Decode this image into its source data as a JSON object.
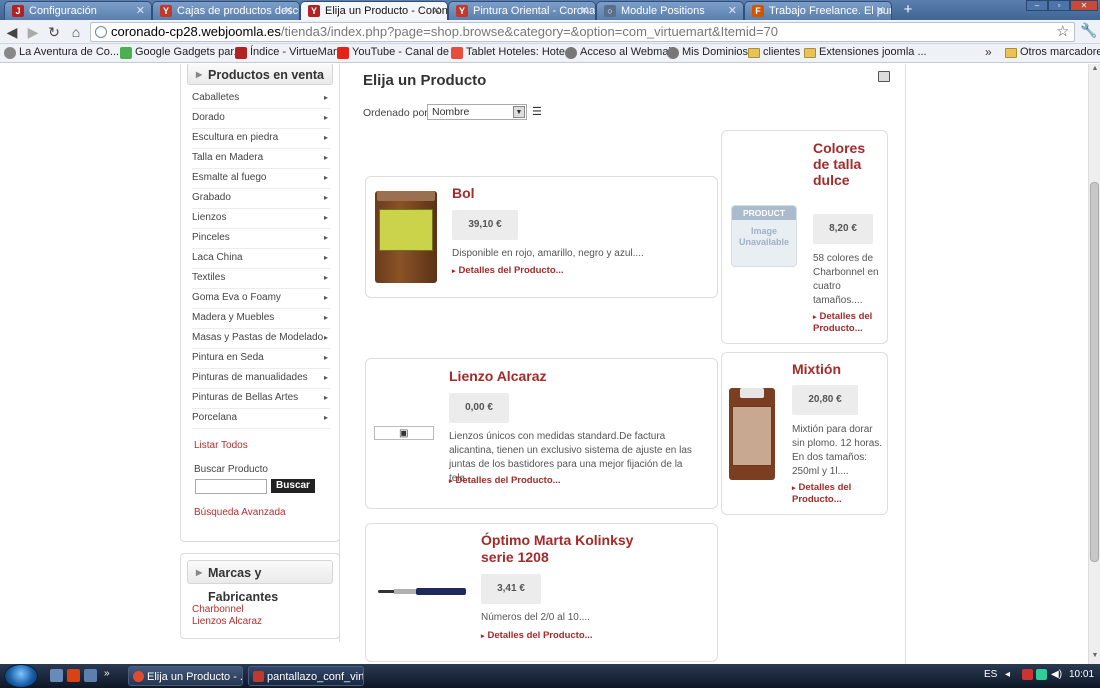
{
  "browser": {
    "tabs": [
      {
        "title": "Configuración",
        "fav": "J",
        "color": "#b22222"
      },
      {
        "title": "Cajas de productos descu",
        "fav": "Y",
        "color": "#c0392b"
      },
      {
        "title": "Elija un Producto - Corona",
        "fav": "Y",
        "color": "#b22222"
      },
      {
        "title": "Pintura Oriental - Coronad",
        "fav": "Y",
        "color": "#c0392b"
      },
      {
        "title": "Module Positions",
        "fav": "○",
        "color": "#5a6f8a"
      },
      {
        "title": "Trabajo Freelance. El punto",
        "fav": "F",
        "color": "#d35400"
      }
    ],
    "url_domain": "coronado-cp28.webjoomla.es",
    "url_path": "/tienda3/index.php?page=shop.browse&category=&option=com_virtuemart&Itemid=70",
    "bookmarks": [
      "La Aventura de Co...",
      "Google Gadgets par...",
      "Índice - VirtueMart",
      "YouTube - Canal de ...",
      "Tablet Hoteles: Hote...",
      "Acceso al Webmail",
      "Mis Dominios",
      "clientes",
      "Extensiones joomla ...",
      "Otros marcadores"
    ]
  },
  "sidebar": {
    "products_title": "Productos en venta",
    "categories": [
      "Caballetes",
      "Dorado",
      "Escultura en piedra",
      "Talla en Madera",
      "Esmalte al fuego",
      "Grabado",
      "Lienzos",
      "Pinceles",
      "Laca China",
      "Textiles",
      "Goma Eva o Foamy",
      "Madera y Muebles",
      "Masas y Pastas de Modelado",
      "Pintura en Seda",
      "Pinturas de manualidades",
      "Pinturas de Bellas Artes",
      "Porcelana"
    ],
    "list_all": "Listar Todos",
    "search_label": "Buscar Producto",
    "search_button": "Buscar",
    "advanced_search": "Búsqueda Avanzada",
    "brands_title": "Marcas y Fabricantes",
    "brands": [
      "Charbonnel",
      "Lienzos Alcaraz"
    ]
  },
  "main": {
    "title": "Elija un Producto",
    "order_label": "Ordenado por:",
    "order_value": "Nombre",
    "more_label": "Detalles del Producto...",
    "unavailable_top": "PRODUCT",
    "unavailable_bottom": "Image Unavailable",
    "products": [
      {
        "name": "Bol",
        "price": "39,10 €",
        "desc": "Disponible en rojo, amarillo, negro y azul...."
      },
      {
        "name": "Colores de talla dulce",
        "price": "8,20 €",
        "desc": "58 colores de Charbonnel en cuatro tamaños...."
      },
      {
        "name": "Lienzo Alcaraz",
        "price": "0,00 €",
        "desc": "Lienzos únicos con medidas standard.De factura alicantina, tienen un exclusivo sistema de ajuste en las juntas de los bastidores para una mejor fijación de la tela...."
      },
      {
        "name": "Mixtión",
        "price": "20,80 €",
        "desc": "Mixtión para dorar sin plomo. 12 horas. En dos tamaños: 250ml y 1l...."
      },
      {
        "name": "Óptimo Marta Kolinksy serie 1208",
        "price": "3,41 €",
        "desc": "Números del 2/0 al 10...."
      }
    ]
  },
  "taskbar": {
    "tasks": [
      "Elija un Producto - ...",
      "pantallazo_conf_virt..."
    ],
    "lang": "ES",
    "clock": "10:01"
  }
}
